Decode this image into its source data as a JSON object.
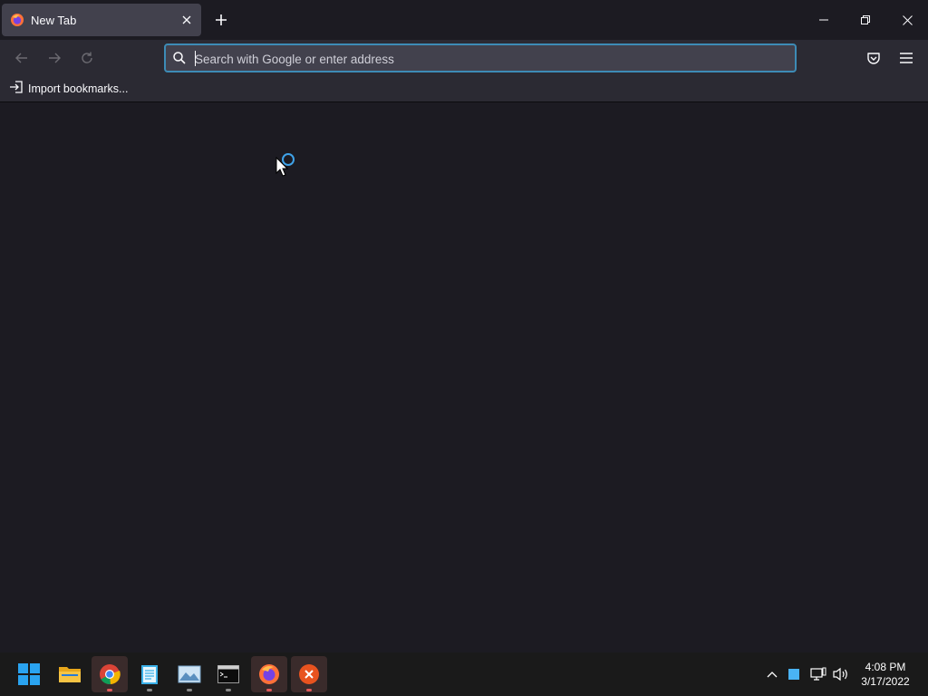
{
  "browser": {
    "tab": {
      "title": "New Tab"
    },
    "urlbar": {
      "placeholder": "Search with Google or enter address",
      "value": ""
    },
    "bookmarks": {
      "import_label": "Import bookmarks..."
    }
  },
  "taskbar": {
    "apps": [
      {
        "name": "start",
        "icon": "windows-logo-icon"
      },
      {
        "name": "file-explorer",
        "icon": "folder-icon"
      },
      {
        "name": "chrome",
        "icon": "chrome-icon"
      },
      {
        "name": "notepad",
        "icon": "notepad-icon"
      },
      {
        "name": "photos",
        "icon": "photos-icon"
      },
      {
        "name": "terminal",
        "icon": "terminal-icon"
      },
      {
        "name": "firefox",
        "icon": "firefox-icon"
      },
      {
        "name": "close-app",
        "icon": "red-x-icon"
      }
    ],
    "clock": {
      "time": "4:08 PM",
      "date": "3/17/2022"
    }
  },
  "colors": {
    "accent": "#3d8bb6",
    "background": "#1c1b22",
    "toolbar": "#2b2a33",
    "tab_selected": "#42414d",
    "spinner": "#3fa2e8"
  }
}
